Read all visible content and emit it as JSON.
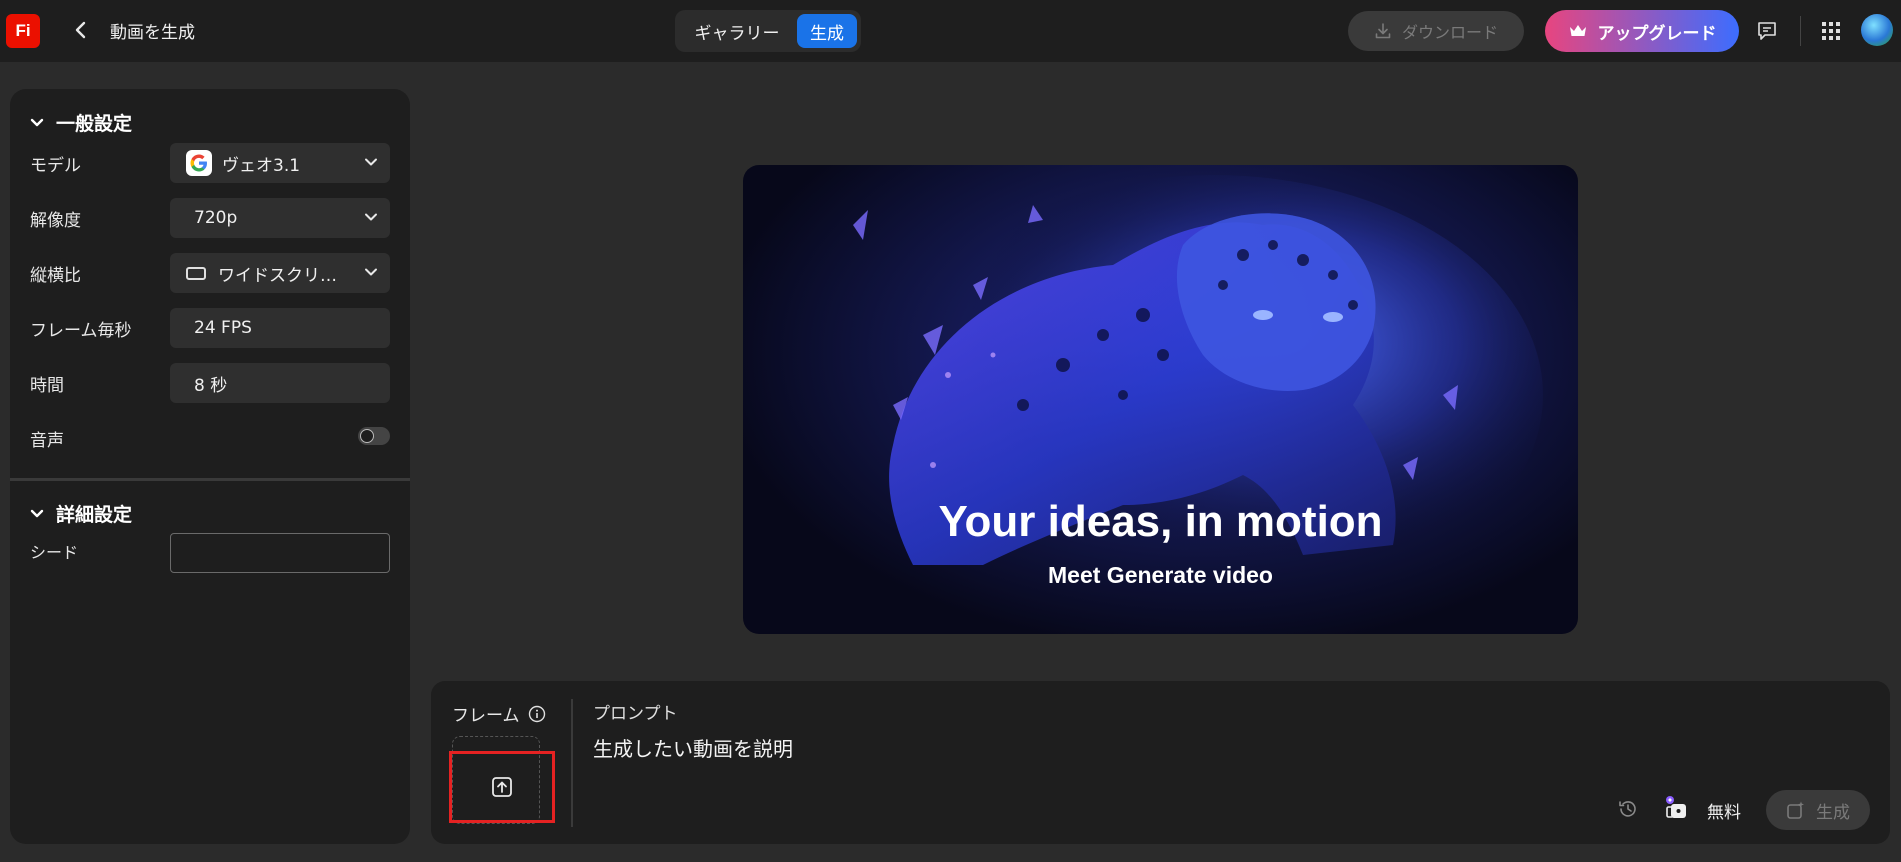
{
  "header": {
    "logo": "Fi",
    "title": "動画を生成",
    "tabs": {
      "gallery": "ギャラリー",
      "generate": "生成"
    },
    "download": "ダウンロード",
    "upgrade": "アップグレード"
  },
  "sidebar": {
    "general": {
      "title": "一般設定",
      "model": {
        "label": "モデル",
        "value": "ヴェオ3.1"
      },
      "resolution": {
        "label": "解像度",
        "value": "720p"
      },
      "aspect": {
        "label": "縦横比",
        "value": "ワイドスクリ…"
      },
      "fps": {
        "label": "フレーム毎秒",
        "value": "24 FPS"
      },
      "duration": {
        "label": "時間",
        "value": "8 秒"
      },
      "audio": {
        "label": "音声",
        "enabled": false
      }
    },
    "advanced": {
      "title": "詳細設定",
      "seed": {
        "label": "シード",
        "value": ""
      }
    }
  },
  "preview": {
    "headline": "Your ideas, in motion",
    "subline": "Meet Generate video"
  },
  "prompt": {
    "frame_label": "フレーム",
    "label": "プロンプト",
    "placeholder": "生成したい動画を説明",
    "credits": "無料",
    "generate": "生成"
  },
  "colors": {
    "accent": "#1a73e8",
    "brand": "#eb1000",
    "highlight": "#e52222"
  }
}
